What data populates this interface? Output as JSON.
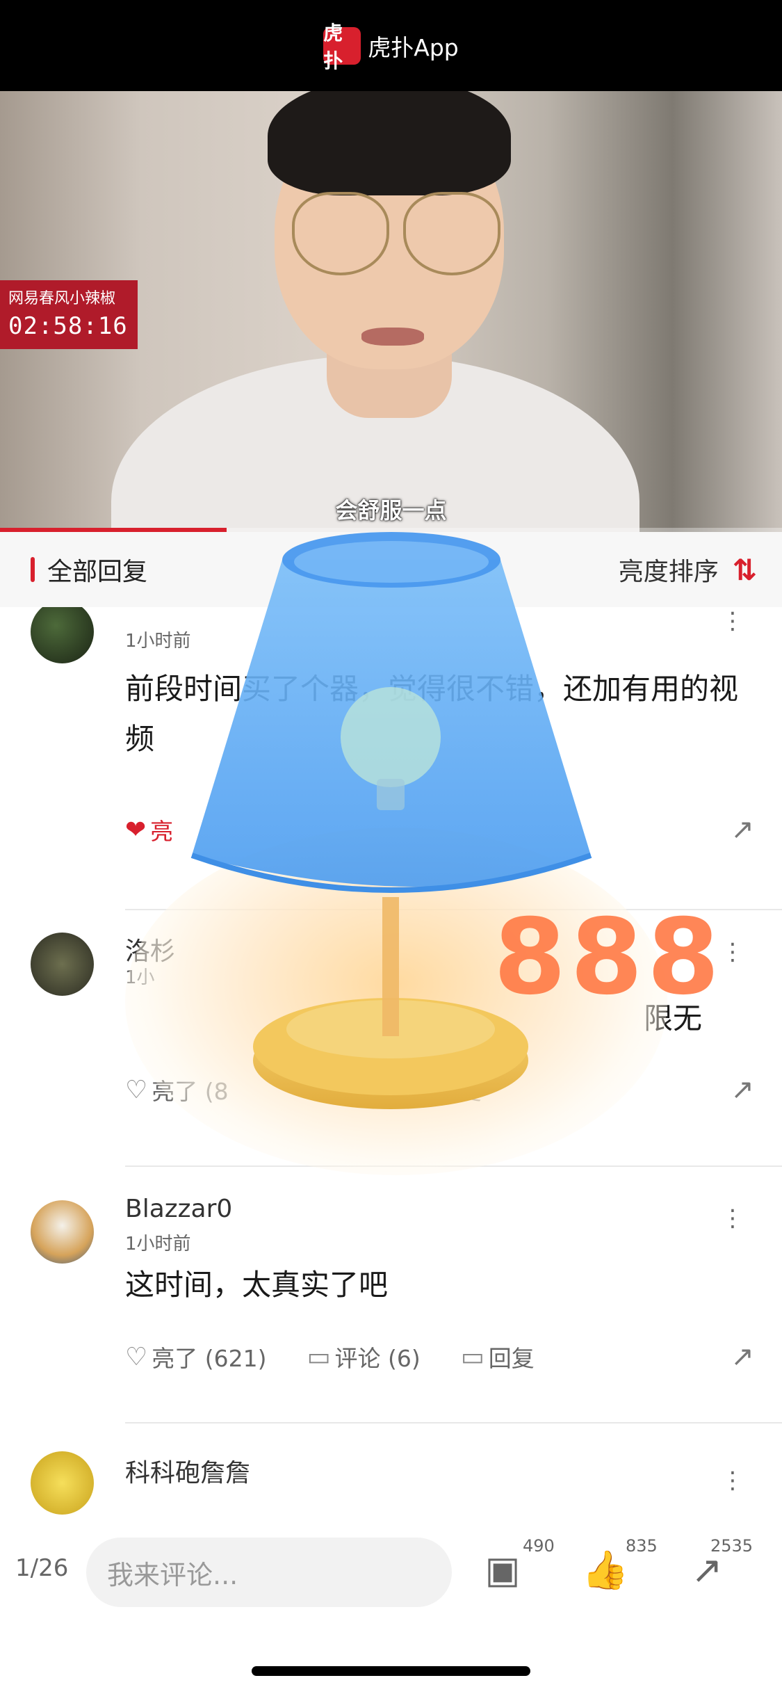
{
  "app_bar": {
    "logo_text": "虎扑",
    "title": "虎扑App"
  },
  "video": {
    "channel_tag": "网易春风小辣椒",
    "timestamp": "02:58:16",
    "subtitle": "会舒服一点",
    "progress_fraction": 0.29
  },
  "section": {
    "title": "全部回复",
    "sort_label": "亮度排序",
    "sort_icon": "sort-arrows-icon"
  },
  "comments": [
    {
      "username": "",
      "time": "1小时前",
      "text": "前段时间买了个器，觉得很不错，还加有用的视频",
      "actions": {
        "like": "亮",
        "comment": "",
        "reply": ""
      },
      "liked": true
    },
    {
      "username": "洛杉",
      "time": "1小",
      "text": "限无",
      "actions": {
        "like": "亮了 (8",
        "comment": "",
        "reply": "回复"
      },
      "liked": false
    },
    {
      "username": "Blazzar0",
      "time": "1小时前",
      "text": "这时间，太真实了吧",
      "actions": {
        "like": "亮了 (621)",
        "comment": "评论 (6)",
        "reply": "回复"
      },
      "liked": false
    },
    {
      "username": "科科砲詹詹",
      "time": "",
      "text": "",
      "actions": {
        "like": "",
        "comment": "",
        "reply": ""
      },
      "liked": false
    }
  ],
  "lamp_overlay": {
    "count": "888",
    "accent": "#ff7a45",
    "shade_color": "#5aa8f5",
    "base_color": "#f0c25a"
  },
  "bottom_bar": {
    "page_indicator": "1/26",
    "comment_placeholder": "我来评论...",
    "comment_count": "490",
    "like_count": "835",
    "share_count": "2535"
  },
  "colors": {
    "brand_red": "#d8202d",
    "top_bar": "#000000"
  }
}
